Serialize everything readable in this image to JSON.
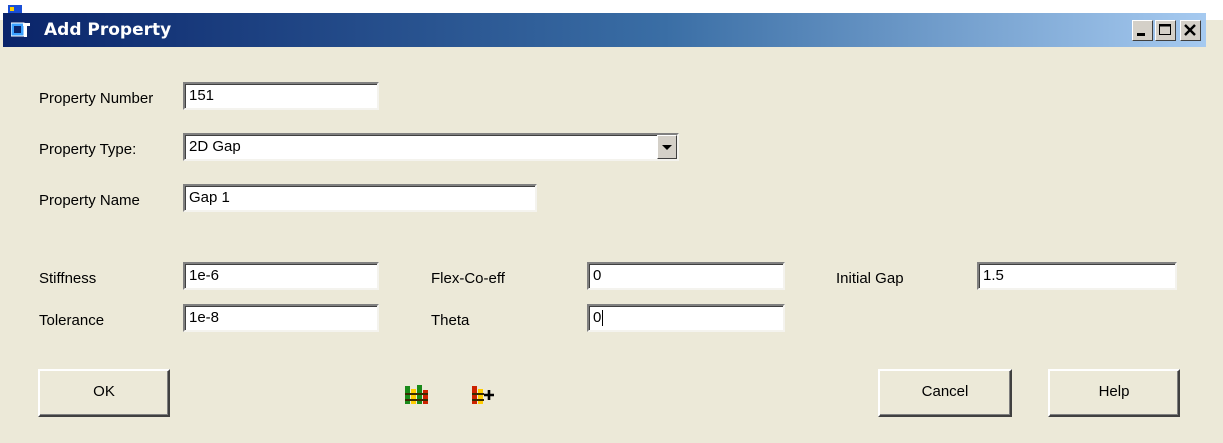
{
  "window": {
    "title": "Add Property",
    "controls": [
      "minimize-icon",
      "maximize-icon",
      "close-icon"
    ]
  },
  "form": {
    "property_number": {
      "label": "Property Number",
      "value": "151"
    },
    "property_type": {
      "label": "Property Type:",
      "value": "2D Gap"
    },
    "property_name": {
      "label": "Property Name",
      "value": "Gap 1"
    },
    "stiffness": {
      "label": "Stiffness",
      "value": "1e-6"
    },
    "tolerance": {
      "label": "Tolerance",
      "value": "1e-8"
    },
    "flex_coeff": {
      "label": "Flex-Co-eff",
      "value": "0"
    },
    "theta": {
      "label": "Theta",
      "value": "0"
    },
    "initial_gap": {
      "label": "Initial Gap",
      "value": "1.5"
    }
  },
  "buttons": {
    "ok": "OK",
    "cancel": "Cancel",
    "help": "Help"
  },
  "toolbar_icons": [
    "property-table-icon",
    "add-property-table-icon"
  ],
  "colors": {
    "caption_start": "#0a246a",
    "caption_end": "#a6caf0",
    "dialog_bg": "#ece9d8"
  }
}
